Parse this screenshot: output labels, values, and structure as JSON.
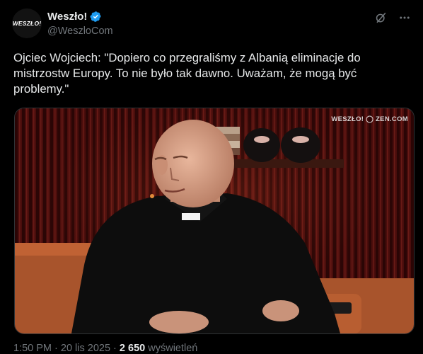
{
  "account": {
    "display_name": "Weszło!",
    "handle": "@WeszloCom",
    "avatar_text": "WESZŁO!",
    "verified_icon": "verified-badge-icon",
    "colors": {
      "verified": "#1d9bf0",
      "avatar_bg": "#121212"
    }
  },
  "actions": {
    "grok_icon": "grok-icon",
    "more_icon": "more-options-icon"
  },
  "post": {
    "text": "Ojciec Wojciech: \"Dopiero co przegraliśmy z Albanią eliminacje do mistrzostw Europy. To nie było tak dawno. Uważam, że mogą być problemy.\""
  },
  "media": {
    "watermark": "WESZŁO! ◯ ZEN.COM"
  },
  "footer": {
    "time_date": "1:50 PM · 20 lis 2025 · ",
    "views_count": "2 650",
    "views_label": " wyświetleń"
  }
}
